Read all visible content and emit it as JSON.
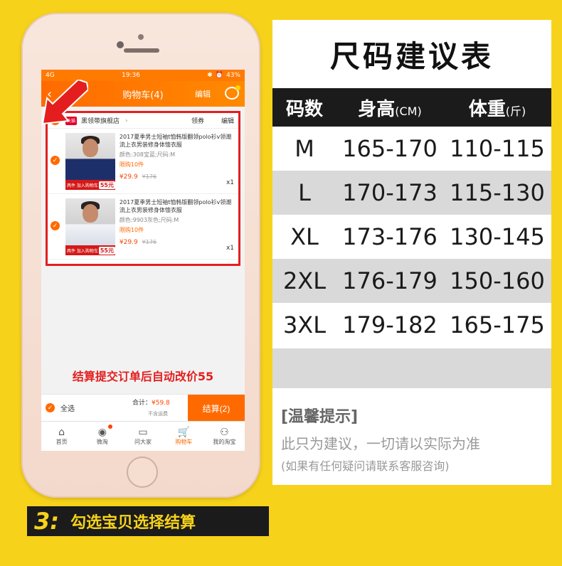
{
  "phone": {
    "statusbar": {
      "network": "4G",
      "time": "19:36",
      "battery": "43%"
    },
    "navbar": {
      "back_icon": "‹",
      "title": "购物车(4)",
      "edit": "编辑"
    },
    "shop": {
      "badge": "天猫",
      "name": "黑领带旗舰店",
      "coupon": "领券",
      "edit": "编辑"
    },
    "items": [
      {
        "title": "2017夏季男士短袖t恤韩版翻领polo衫v领潮流上衣男装修身体恤衣服",
        "desc": "颜色:308宝蓝;尺码:M",
        "stock": "限购10件",
        "price": "¥29.9",
        "old_price": "¥176",
        "qty": "x1",
        "ribbon_text": "两件 加入购物车",
        "ribbon_badge": "55元"
      },
      {
        "title": "2017夏季男士短袖t恤韩版翻领polo衫v领潮流上衣男装修身体恤衣服",
        "desc": "颜色:9903灰色;尺码:M",
        "stock": "限购10件",
        "price": "¥29.9",
        "old_price": "¥176",
        "qty": "x1",
        "ribbon_text": "两件 加入购物车",
        "ribbon_badge": "55元"
      }
    ],
    "promo": "结算提交订单后自动改价55",
    "checkout": {
      "select_all": "全选",
      "total_label": "合计：",
      "total_amount": "¥59.8",
      "freight": "不含运费",
      "pay_button": "结算(2)"
    },
    "tabs": [
      {
        "icon": "home-icon",
        "label": "首页"
      },
      {
        "icon": "broadcast-icon",
        "label": "微淘"
      },
      {
        "icon": "chat-icon",
        "label": "问大家"
      },
      {
        "icon": "cart-icon",
        "label": "购物车"
      },
      {
        "icon": "user-icon",
        "label": "我的淘宝"
      }
    ]
  },
  "size_table": {
    "title": "尺码建议表",
    "headers": {
      "size": "码数",
      "height": "身高",
      "height_unit": "(CM)",
      "weight": "体重",
      "weight_unit": "(斤)"
    },
    "rows": [
      {
        "size": "M",
        "height": "165-170",
        "weight": "110-115"
      },
      {
        "size": "L",
        "height": "170-173",
        "weight": "115-130"
      },
      {
        "size": "XL",
        "height": "173-176",
        "weight": "130-145"
      },
      {
        "size": "2XL",
        "height": "176-179",
        "weight": "150-160"
      },
      {
        "size": "3XL",
        "height": "179-182",
        "weight": "165-175"
      }
    ],
    "tips_title": "[温馨提示]",
    "tips_line1": "此只为建议，一切请以实际为准",
    "tips_line2": "(如果有任何疑问请联系客服咨询)"
  },
  "step": {
    "number": "3:",
    "text": "勾选宝贝选择结算"
  },
  "colors": {
    "background": "#f7d21b",
    "accent": "#ff6a00",
    "alert": "#e41e1e",
    "dark": "#1b1b1b"
  }
}
